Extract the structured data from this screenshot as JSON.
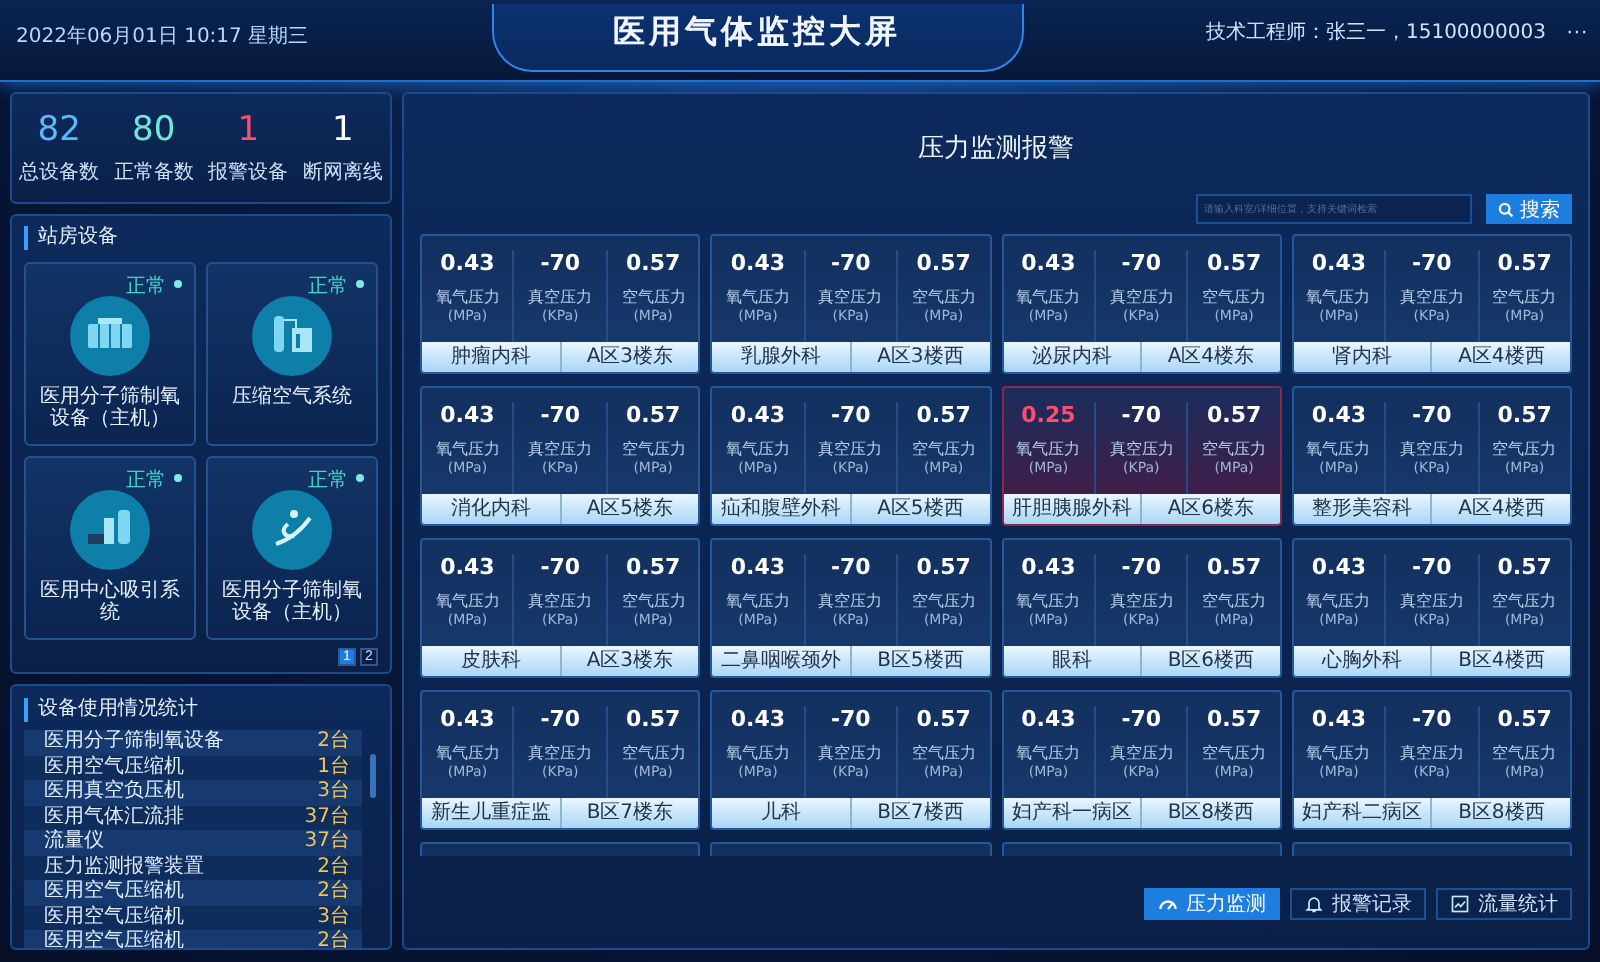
{
  "header": {
    "datetime": "2022年06月01日 10:17 星期三",
    "title": "医用气体监控大屏",
    "engineer": "技术工程师：张三一，15100000003",
    "menu": "···"
  },
  "stats": [
    {
      "value": "82",
      "label": "总设备数",
      "color": "#5ab8ff"
    },
    {
      "value": "80",
      "label": "正常备数",
      "color": "#6ee8d4"
    },
    {
      "value": "1",
      "label": "报警设备",
      "color": "#ff4d6d"
    },
    {
      "value": "1",
      "label": "断网离线",
      "color": "#ffffff"
    }
  ],
  "station": {
    "title": "站房设备",
    "devices": [
      {
        "name": "医用分子筛制氧设备（主机）",
        "status": "正常"
      },
      {
        "name": "压缩空气系统",
        "status": "正常"
      },
      {
        "name": "医用中心吸引系统",
        "status": "正常"
      },
      {
        "name": "医用分子筛制氧设备（主机）",
        "status": "正常"
      }
    ],
    "pages": [
      {
        "label": "1",
        "selected": true
      },
      {
        "label": "2",
        "selected": false
      }
    ]
  },
  "usage": {
    "title": "设备使用情况统计",
    "rows": [
      {
        "name": "医用分子筛制氧设备",
        "count": "2台"
      },
      {
        "name": "医用空气压缩机",
        "count": "1台"
      },
      {
        "name": "医用真空负压机",
        "count": "3台"
      },
      {
        "name": "医用气体汇流排",
        "count": "37台"
      },
      {
        "name": "流量仪",
        "count": "37台"
      },
      {
        "name": "压力监测报警装置",
        "count": "2台"
      },
      {
        "name": "医用空气压缩机",
        "count": "2台"
      },
      {
        "name": "医用空气压缩机",
        "count": "3台"
      },
      {
        "name": "医用空气压缩机",
        "count": "2台"
      }
    ]
  },
  "monitor": {
    "title": "压力监测报警",
    "search": {
      "placeholder": "请输入科室/详细位置，支持关键词检索",
      "button": "搜索"
    },
    "cards": [
      {
        "dept": "肿瘤内科",
        "location": "A区3楼东",
        "alarm": false,
        "metrics": [
          {
            "value": "0.43",
            "label": "氧气压力",
            "unit": "(MPa)",
            "alarm": false
          },
          {
            "value": "-70",
            "label": "真空压力",
            "unit": "(KPa)",
            "alarm": false
          },
          {
            "value": "0.57",
            "label": "空气压力",
            "unit": "(MPa)",
            "alarm": false
          }
        ]
      },
      {
        "dept": "乳腺外科",
        "location": "A区3楼西",
        "alarm": false,
        "metrics": [
          {
            "value": "0.43",
            "label": "氧气压力",
            "unit": "(MPa)",
            "alarm": false
          },
          {
            "value": "-70",
            "label": "真空压力",
            "unit": "(KPa)",
            "alarm": false
          },
          {
            "value": "0.57",
            "label": "空气压力",
            "unit": "(MPa)",
            "alarm": false
          }
        ]
      },
      {
        "dept": "泌尿内科",
        "location": "A区4楼东",
        "alarm": false,
        "metrics": [
          {
            "value": "0.43",
            "label": "氧气压力",
            "unit": "(MPa)",
            "alarm": false
          },
          {
            "value": "-70",
            "label": "真空压力",
            "unit": "(KPa)",
            "alarm": false
          },
          {
            "value": "0.57",
            "label": "空气压力",
            "unit": "(MPa)",
            "alarm": false
          }
        ]
      },
      {
        "dept": "肾内科",
        "location": "A区4楼西",
        "alarm": false,
        "metrics": [
          {
            "value": "0.43",
            "label": "氧气压力",
            "unit": "(MPa)",
            "alarm": false
          },
          {
            "value": "-70",
            "label": "真空压力",
            "unit": "(KPa)",
            "alarm": false
          },
          {
            "value": "0.57",
            "label": "空气压力",
            "unit": "(MPa)",
            "alarm": false
          }
        ]
      },
      {
        "dept": "消化内科",
        "location": "A区5楼东",
        "alarm": false,
        "metrics": [
          {
            "value": "0.43",
            "label": "氧气压力",
            "unit": "(MPa)",
            "alarm": false
          },
          {
            "value": "-70",
            "label": "真空压力",
            "unit": "(KPa)",
            "alarm": false
          },
          {
            "value": "0.57",
            "label": "空气压力",
            "unit": "(MPa)",
            "alarm": false
          }
        ]
      },
      {
        "dept": "疝和腹壁外科",
        "location": "A区5楼西",
        "alarm": false,
        "metrics": [
          {
            "value": "0.43",
            "label": "氧气压力",
            "unit": "(MPa)",
            "alarm": false
          },
          {
            "value": "-70",
            "label": "真空压力",
            "unit": "(KPa)",
            "alarm": false
          },
          {
            "value": "0.57",
            "label": "空气压力",
            "unit": "(MPa)",
            "alarm": false
          }
        ]
      },
      {
        "dept": "肝胆胰腺外科",
        "location": "A区6楼东",
        "alarm": true,
        "metrics": [
          {
            "value": "0.25",
            "label": "氧气压力",
            "unit": "(MPa)",
            "alarm": true
          },
          {
            "value": "-70",
            "label": "真空压力",
            "unit": "(KPa)",
            "alarm": false
          },
          {
            "value": "0.57",
            "label": "空气压力",
            "unit": "(MPa)",
            "alarm": false
          }
        ]
      },
      {
        "dept": "整形美容科",
        "location": "A区4楼西",
        "alarm": false,
        "metrics": [
          {
            "value": "0.43",
            "label": "氧气压力",
            "unit": "(MPa)",
            "alarm": false
          },
          {
            "value": "-70",
            "label": "真空压力",
            "unit": "(KPa)",
            "alarm": false
          },
          {
            "value": "0.57",
            "label": "空气压力",
            "unit": "(MPa)",
            "alarm": false
          }
        ]
      },
      {
        "dept": "皮肤科",
        "location": "A区3楼东",
        "alarm": false,
        "metrics": [
          {
            "value": "0.43",
            "label": "氧气压力",
            "unit": "(MPa)",
            "alarm": false
          },
          {
            "value": "-70",
            "label": "真空压力",
            "unit": "(KPa)",
            "alarm": false
          },
          {
            "value": "0.57",
            "label": "空气压力",
            "unit": "(MPa)",
            "alarm": false
          }
        ]
      },
      {
        "dept": "二鼻咽喉颈外",
        "location": "B区5楼西",
        "alarm": false,
        "metrics": [
          {
            "value": "0.43",
            "label": "氧气压力",
            "unit": "(MPa)",
            "alarm": false
          },
          {
            "value": "-70",
            "label": "真空压力",
            "unit": "(KPa)",
            "alarm": false
          },
          {
            "value": "0.57",
            "label": "空气压力",
            "unit": "(MPa)",
            "alarm": false
          }
        ]
      },
      {
        "dept": "眼科",
        "location": "B区6楼西",
        "alarm": false,
        "metrics": [
          {
            "value": "0.43",
            "label": "氧气压力",
            "unit": "(MPa)",
            "alarm": false
          },
          {
            "value": "-70",
            "label": "真空压力",
            "unit": "(KPa)",
            "alarm": false
          },
          {
            "value": "0.57",
            "label": "空气压力",
            "unit": "(MPa)",
            "alarm": false
          }
        ]
      },
      {
        "dept": "心胸外科",
        "location": "B区4楼西",
        "alarm": false,
        "metrics": [
          {
            "value": "0.43",
            "label": "氧气压力",
            "unit": "(MPa)",
            "alarm": false
          },
          {
            "value": "-70",
            "label": "真空压力",
            "unit": "(KPa)",
            "alarm": false
          },
          {
            "value": "0.57",
            "label": "空气压力",
            "unit": "(MPa)",
            "alarm": false
          }
        ]
      },
      {
        "dept": "新生儿重症监",
        "location": "B区7楼东",
        "alarm": false,
        "metrics": [
          {
            "value": "0.43",
            "label": "氧气压力",
            "unit": "(MPa)",
            "alarm": false
          },
          {
            "value": "-70",
            "label": "真空压力",
            "unit": "(KPa)",
            "alarm": false
          },
          {
            "value": "0.57",
            "label": "空气压力",
            "unit": "(MPa)",
            "alarm": false
          }
        ]
      },
      {
        "dept": "儿科",
        "location": "B区7楼西",
        "alarm": false,
        "metrics": [
          {
            "value": "0.43",
            "label": "氧气压力",
            "unit": "(MPa)",
            "alarm": false
          },
          {
            "value": "-70",
            "label": "真空压力",
            "unit": "(KPa)",
            "alarm": false
          },
          {
            "value": "0.57",
            "label": "空气压力",
            "unit": "(MPa)",
            "alarm": false
          }
        ]
      },
      {
        "dept": "妇产科一病区",
        "location": "B区8楼西",
        "alarm": false,
        "metrics": [
          {
            "value": "0.43",
            "label": "氧气压力",
            "unit": "(MPa)",
            "alarm": false
          },
          {
            "value": "-70",
            "label": "真空压力",
            "unit": "(KPa)",
            "alarm": false
          },
          {
            "value": "0.57",
            "label": "空气压力",
            "unit": "(MPa)",
            "alarm": false
          }
        ]
      },
      {
        "dept": "妇产科二病区",
        "location": "B区8楼西",
        "alarm": false,
        "metrics": [
          {
            "value": "0.43",
            "label": "氧气压力",
            "unit": "(MPa)",
            "alarm": false
          },
          {
            "value": "-70",
            "label": "真空压力",
            "unit": "(KPa)",
            "alarm": false
          },
          {
            "value": "0.57",
            "label": "空气压力",
            "unit": "(MPa)",
            "alarm": false
          }
        ]
      }
    ],
    "tabs": [
      {
        "label": "压力监测",
        "selected": true
      },
      {
        "label": "报警记录",
        "selected": false
      },
      {
        "label": "流量统计",
        "selected": false
      }
    ]
  }
}
